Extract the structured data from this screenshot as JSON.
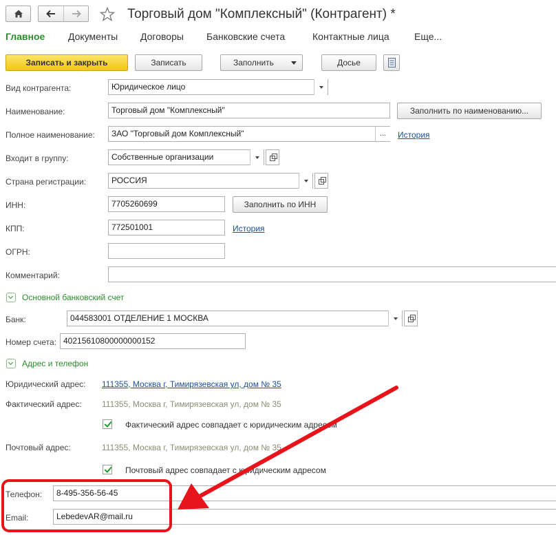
{
  "window": {
    "title": "Торговый дом \"Комплексный\" (Контрагент) *",
    "icons": [
      "home-icon",
      "back-arrow-icon",
      "forward-arrow-icon",
      "star-icon"
    ]
  },
  "menu": {
    "items": [
      "Главное",
      "Документы",
      "Договоры",
      "Банковские счета",
      "Контактные лица",
      "Еще..."
    ],
    "active": "Главное"
  },
  "toolbar": {
    "save_close": "Записать и закрыть",
    "save": "Записать",
    "fill": "Заполнить",
    "dossier": "Досье",
    "report_icon": "report-icon"
  },
  "fields": {
    "kind": {
      "label": "Вид контрагента:",
      "value": "Юридическое лицо"
    },
    "name": {
      "label": "Наименование:",
      "value": "Торговый дом \"Комплексный\"",
      "button": "Заполнить по наименованию..."
    },
    "full_name": {
      "label": "Полное наименование:",
      "value": "ЗАО \"Торговый дом Комплексный\"",
      "select": "...",
      "link": "История"
    },
    "group": {
      "label": "Входит в группу:",
      "value": "Собственные организации"
    },
    "country": {
      "label": "Страна регистрации:",
      "value": "РОССИЯ"
    },
    "inn": {
      "label": "ИНН:",
      "value": "7705260699",
      "button": "Заполнить по ИНН"
    },
    "kpp": {
      "label": "КПП:",
      "value": "772501001",
      "link": "История"
    },
    "ogrn": {
      "label": "ОГРН:",
      "value": ""
    },
    "comment": {
      "label": "Комментарий:",
      "value": ""
    }
  },
  "bank_section": {
    "title": "Основной банковский счет",
    "bank": {
      "label": "Банк:",
      "value": "044583001 ОТДЕЛЕНИЕ 1 МОСКВА"
    },
    "account": {
      "label": "Номер счета:",
      "value": "40215610800000000152"
    }
  },
  "address_section": {
    "title": "Адрес и телефон",
    "legal": {
      "label": "Юридический адрес:",
      "value": "111355, Москва г, Тимирязевская ул, дом № 35"
    },
    "actual": {
      "label": "Фактический адрес:",
      "value": "111355, Москва г, Тимирязевская ул, дом № 35"
    },
    "actual_same": {
      "label": "Фактический адрес совпадает с юридическим адресом",
      "checked": true
    },
    "postal": {
      "label": "Почтовый адрес:",
      "value": "111355, Москва г, Тимирязевская ул, дом № 35"
    },
    "postal_same": {
      "label": "Почтовый адрес совпадает с юридическим адресом",
      "checked": true
    },
    "phone": {
      "label": "Телефон:",
      "value": "8-495-356-56-45"
    },
    "email": {
      "label": "Email:",
      "value": "LebedevAR@mail.ru"
    }
  },
  "colors": {
    "accent_green": "#2a8f2a",
    "primary_button": "#f1c615",
    "link_blue": "#1a4f9c",
    "annotation_red": "#e8141b"
  }
}
